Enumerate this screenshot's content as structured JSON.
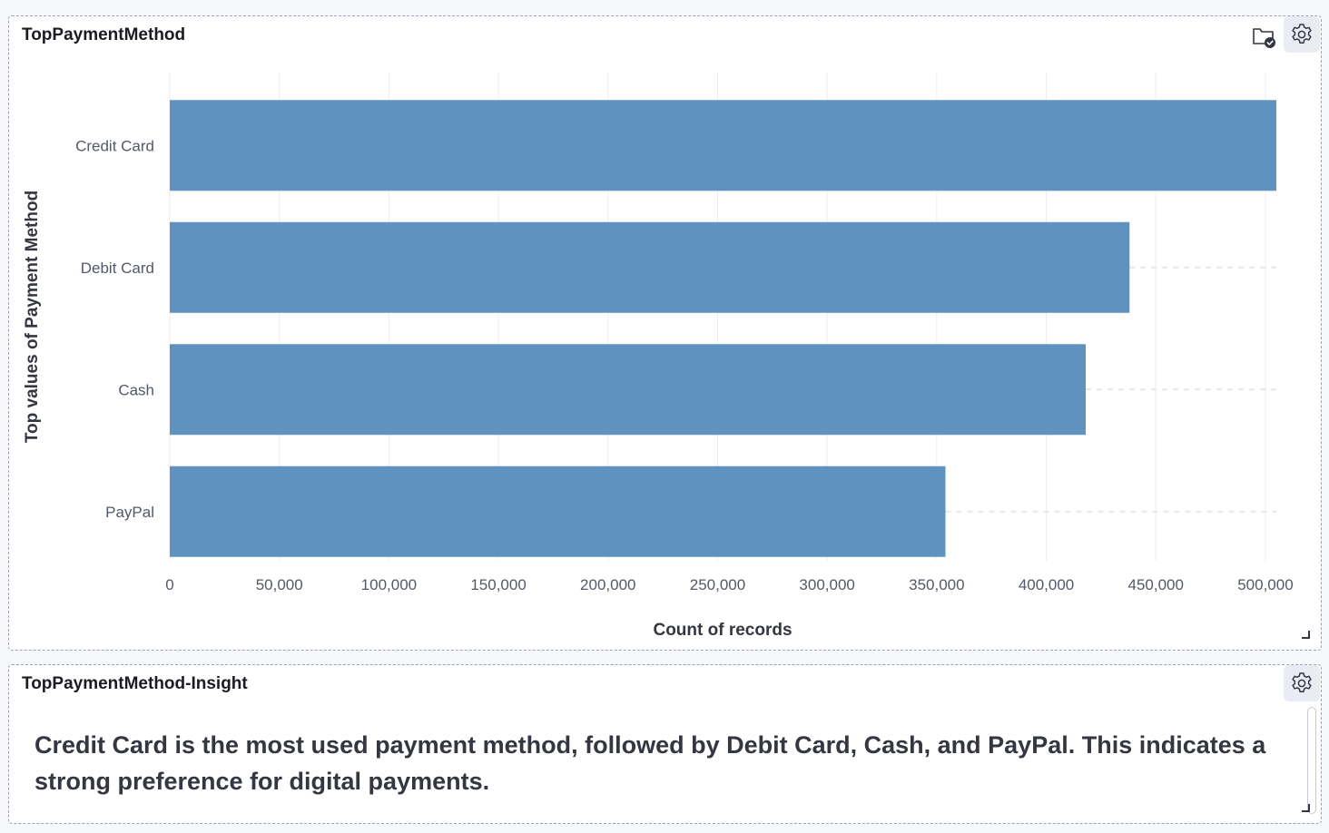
{
  "chart_panel": {
    "title": "TopPaymentMethod",
    "icons": [
      "folder-check-icon",
      "gear-icon"
    ]
  },
  "insight_panel": {
    "title": "TopPaymentMethod-Insight",
    "text": "Credit Card is the most used payment method, followed by Debit Card, Cash, and PayPal. This indicates a strong preference for digital payments.",
    "icons": [
      "gear-icon"
    ]
  },
  "colors": {
    "bar": "#6092bf",
    "grid": "#eceef2",
    "text": "#343741",
    "title": "#1a1c21"
  },
  "chart_data": {
    "type": "bar",
    "orientation": "horizontal",
    "title": "",
    "xlabel": "Count of records",
    "ylabel": "Top values of Payment Method",
    "categories": [
      "Credit Card",
      "Debit Card",
      "Cash",
      "PayPal"
    ],
    "values": [
      505000,
      438000,
      418000,
      354000
    ],
    "xlim": [
      0,
      505000
    ],
    "xticks": [
      0,
      50000,
      100000,
      150000,
      200000,
      250000,
      300000,
      350000,
      400000,
      450000,
      500000
    ],
    "xtick_labels": [
      "0",
      "50,000",
      "100,000",
      "150,000",
      "200,000",
      "250,000",
      "300,000",
      "350,000",
      "400,000",
      "450,000",
      "500,000"
    ],
    "grid": true,
    "legend": "none"
  }
}
